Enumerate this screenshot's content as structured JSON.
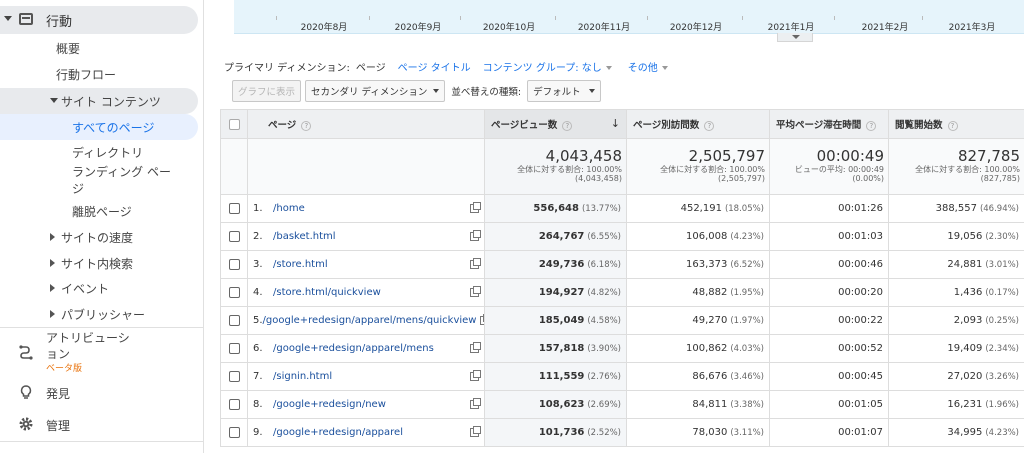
{
  "sidebar": {
    "top_section": "行動",
    "items": [
      {
        "label": "概要"
      },
      {
        "label": "行動フロー"
      }
    ],
    "site_content": "サイト コンテンツ",
    "site_content_items": [
      {
        "label": "すべてのページ",
        "active": true
      },
      {
        "label": "ディレクトリ"
      },
      {
        "label": "ランディング ページ"
      },
      {
        "label": "離脱ページ"
      }
    ],
    "collapsed_sections": [
      {
        "label": "サイトの速度"
      },
      {
        "label": "サイト内検索"
      },
      {
        "label": "イベント"
      },
      {
        "label": "パブリッシャー"
      }
    ],
    "attribution": {
      "label": "アトリビューション",
      "badge": "ベータ版"
    },
    "discover": "発見",
    "admin": "管理"
  },
  "chart": {
    "months": [
      "2020年8月",
      "2020年9月",
      "2020年10月",
      "2020年11月",
      "2020年12月",
      "2021年1月",
      "2021年2月",
      "2021年3月"
    ]
  },
  "dimensions": {
    "primary_label": "プライマリ ディメンション:",
    "current": "ページ",
    "options": [
      "ページ タイトル",
      "コンテンツ グループ: なし",
      "その他"
    ]
  },
  "controls": {
    "graph_button": "グラフに表示",
    "secondary_dimension": "セカンダリ ディメンション",
    "sort_label": "並べ替えの種類:",
    "sort_value": "デフォルト"
  },
  "table": {
    "headers": {
      "page": "ページ",
      "pageviews": "ページビュー数",
      "unique": "ページ別訪問数",
      "avg_time": "平均ページ滞在時間",
      "entrances": "閲覧開始数"
    },
    "totals": {
      "pageviews": {
        "value": "4,043,458",
        "line1": "全体に対する割合: 100.00%",
        "line2": "(4,043,458)"
      },
      "unique": {
        "value": "2,505,797",
        "line1": "全体に対する割合: 100.00%",
        "line2": "(2,505,797)"
      },
      "avg_time": {
        "value": "00:00:49",
        "line1": "ビューの平均: 00:00:49",
        "line2": "(0.00%)"
      },
      "entrances": {
        "value": "827,785",
        "line1": "全体に対する割合: 100.00%",
        "line2": "(827,785)"
      }
    },
    "rows": [
      {
        "n": "1.",
        "page": "/home",
        "pv": "556,648",
        "pv_pct": "(13.77%)",
        "up": "452,191",
        "up_pct": "(18.05%)",
        "time": "00:01:26",
        "ent": "388,557",
        "ent_pct": "(46.94%)"
      },
      {
        "n": "2.",
        "page": "/basket.html",
        "pv": "264,767",
        "pv_pct": "(6.55%)",
        "up": "106,008",
        "up_pct": "(4.23%)",
        "time": "00:01:03",
        "ent": "19,056",
        "ent_pct": "(2.30%)"
      },
      {
        "n": "3.",
        "page": "/store.html",
        "pv": "249,736",
        "pv_pct": "(6.18%)",
        "up": "163,373",
        "up_pct": "(6.52%)",
        "time": "00:00:46",
        "ent": "24,881",
        "ent_pct": "(3.01%)"
      },
      {
        "n": "4.",
        "page": "/store.html/quickview",
        "pv": "194,927",
        "pv_pct": "(4.82%)",
        "up": "48,882",
        "up_pct": "(1.95%)",
        "time": "00:00:20",
        "ent": "1,436",
        "ent_pct": "(0.17%)"
      },
      {
        "n": "5.",
        "page": "/google+redesign/apparel/mens/quickview",
        "pv": "185,049",
        "pv_pct": "(4.58%)",
        "up": "49,270",
        "up_pct": "(1.97%)",
        "time": "00:00:22",
        "ent": "2,093",
        "ent_pct": "(0.25%)"
      },
      {
        "n": "6.",
        "page": "/google+redesign/apparel/mens",
        "pv": "157,818",
        "pv_pct": "(3.90%)",
        "up": "100,862",
        "up_pct": "(4.03%)",
        "time": "00:00:52",
        "ent": "19,409",
        "ent_pct": "(2.34%)"
      },
      {
        "n": "7.",
        "page": "/signin.html",
        "pv": "111,559",
        "pv_pct": "(2.76%)",
        "up": "86,676",
        "up_pct": "(3.46%)",
        "time": "00:00:45",
        "ent": "27,020",
        "ent_pct": "(3.26%)"
      },
      {
        "n": "8.",
        "page": "/google+redesign/new",
        "pv": "108,623",
        "pv_pct": "(2.69%)",
        "up": "84,811",
        "up_pct": "(3.38%)",
        "time": "00:01:05",
        "ent": "16,231",
        "ent_pct": "(1.96%)"
      },
      {
        "n": "9.",
        "page": "/google+redesign/apparel",
        "pv": "101,736",
        "pv_pct": "(2.52%)",
        "up": "78,030",
        "up_pct": "(3.11%)",
        "time": "00:01:07",
        "ent": "34,995",
        "ent_pct": "(4.23%)"
      }
    ]
  }
}
